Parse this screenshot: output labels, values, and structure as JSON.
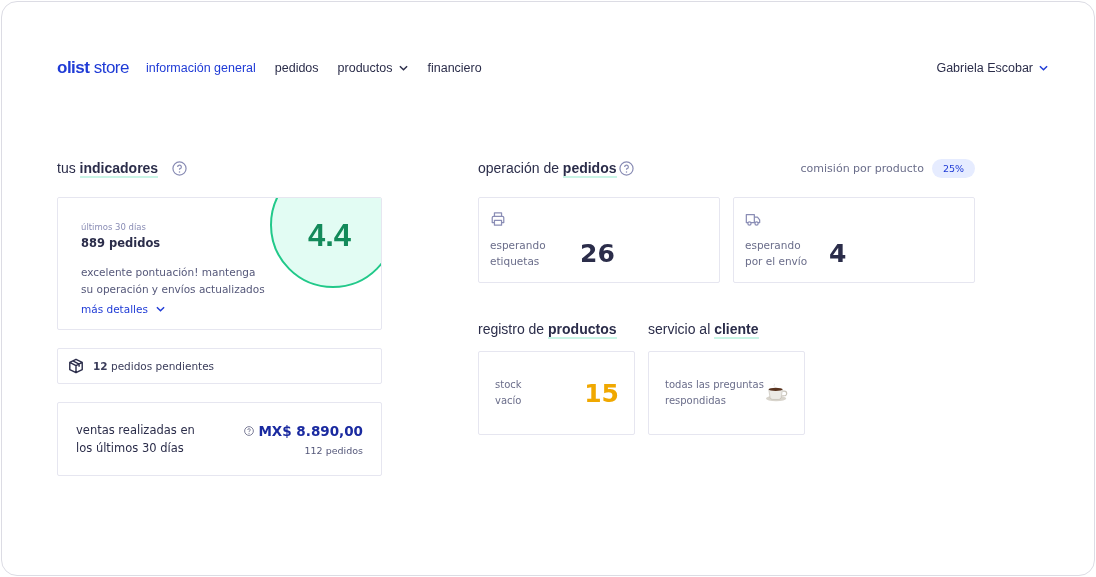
{
  "brand": {
    "name": "olist",
    "suffix": "store"
  },
  "nav": [
    {
      "label": "información general",
      "selected": true,
      "dropdown": false
    },
    {
      "label": "pedidos",
      "selected": false,
      "dropdown": false
    },
    {
      "label": "productos",
      "selected": false,
      "dropdown": true
    },
    {
      "label": "financiero",
      "selected": false,
      "dropdown": false
    }
  ],
  "user": {
    "name": "Gabriela Escobar"
  },
  "indicators": {
    "heading": "tus **indicadores**",
    "period": "últimos 30 días",
    "orders": "889 pedidos",
    "score": "4.4",
    "message": "excelente pontuación! mantenga su operación y envíos actualizados",
    "details_link": "más detalles"
  },
  "pending": {
    "count": "12",
    "text": "pedidos pendientes"
  },
  "sales": {
    "label": "ventas realizadas en los últimos 30 días",
    "amount": "MX$ 8.890,00",
    "orders": "112 pedidos"
  },
  "operation": {
    "heading": "operación de **pedidos**",
    "commission_label": "comisión por producto",
    "commission": "25%",
    "cards": [
      {
        "kind": "printer",
        "label": "esperando etiquetas",
        "value": "26"
      },
      {
        "kind": "truck",
        "label": "esperando por el envío",
        "value": "4"
      }
    ]
  },
  "products": {
    "heading": "registro de **productos**",
    "label": "stock vacío",
    "value": "15"
  },
  "service": {
    "heading": "servicio al **cliente**",
    "label": "todas las preguntas respondidas"
  }
}
